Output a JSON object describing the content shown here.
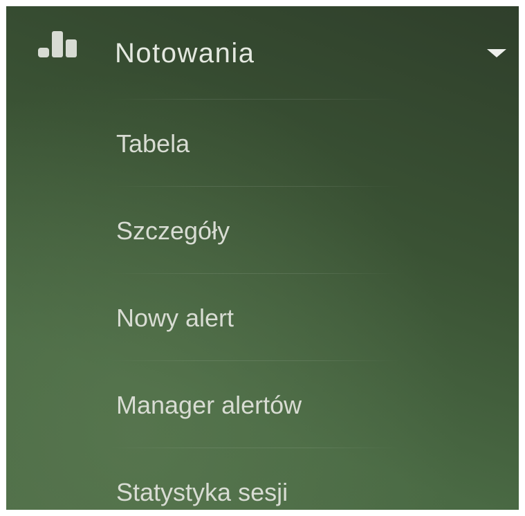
{
  "menu": {
    "header": {
      "label": "Notowania",
      "icon": "bar-chart-icon",
      "toggle_icon": "caret-down-icon",
      "expanded": true
    },
    "items": [
      {
        "label": "Tabela"
      },
      {
        "label": "Szczegóły"
      },
      {
        "label": "Nowy alert"
      },
      {
        "label": "Manager alertów"
      },
      {
        "label": "Statystyka sesji"
      }
    ]
  },
  "colors": {
    "panel_dark": "#2f3f2b",
    "panel_light": "#4d6c46",
    "text_header": "#e4e8e0",
    "text_item": "#d8dcd3",
    "icon": "#d7dbd3"
  }
}
